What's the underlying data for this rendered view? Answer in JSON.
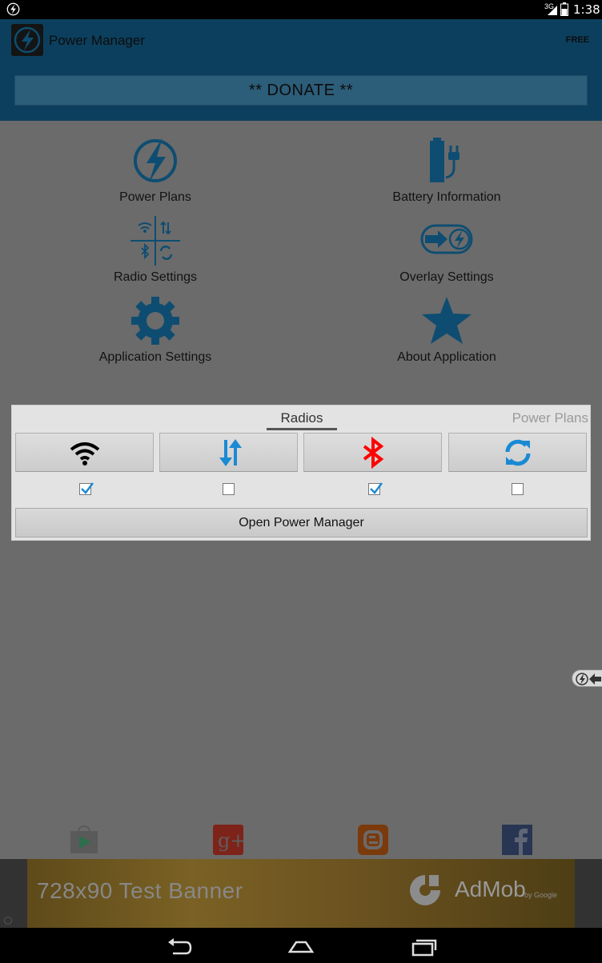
{
  "status_bar": {
    "network": "3G",
    "time": "1:38"
  },
  "app": {
    "title": "Power Manager",
    "edition": "FREE",
    "donate_label": "** DONATE **"
  },
  "features": [
    {
      "label": "Power Plans",
      "icon": "power-bolt-icon"
    },
    {
      "label": "Battery Information",
      "icon": "battery-plug-icon"
    },
    {
      "label": "Radio Settings",
      "icon": "radio-grid-icon"
    },
    {
      "label": "Overlay Settings",
      "icon": "overlay-arrow-icon"
    },
    {
      "label": "Application Settings",
      "icon": "gear-icon"
    },
    {
      "label": "About Application",
      "icon": "star-icon"
    }
  ],
  "widget": {
    "tabs": {
      "active": "Radios",
      "next": "Power Plans"
    },
    "radios": [
      {
        "name": "wifi",
        "icon": "wifi-icon",
        "checked": true
      },
      {
        "name": "mobile-data",
        "icon": "data-arrows-icon",
        "checked": false
      },
      {
        "name": "bluetooth",
        "icon": "bluetooth-icon",
        "checked": true
      },
      {
        "name": "sync",
        "icon": "sync-icon",
        "checked": false
      }
    ],
    "open_label": "Open Power Manager"
  },
  "social": [
    "play-store-icon",
    "google-plus-icon",
    "blogger-icon",
    "facebook-icon"
  ],
  "ad": {
    "banner_text": "728x90   Test Banner",
    "brand": "AdMob",
    "by": "by Google"
  },
  "colors": {
    "accent": "#0e4d71",
    "bluetooth": "#ff0000",
    "data": "#1a8ad4"
  }
}
